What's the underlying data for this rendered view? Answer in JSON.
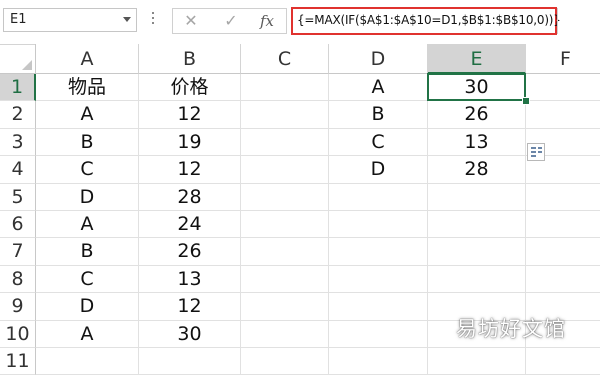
{
  "formula_bar": {
    "name_box": "E1",
    "cancel_icon": "✕",
    "enter_icon": "✓",
    "fx_icon": "fx",
    "formula": "{=MAX(IF($A$1:$A$10=D1,$B$1:$B$10,0))}"
  },
  "columns": [
    "A",
    "B",
    "C",
    "D",
    "E",
    "F"
  ],
  "rows": [
    "1",
    "2",
    "3",
    "4",
    "5",
    "6",
    "7",
    "8",
    "9",
    "10",
    "11"
  ],
  "selected": {
    "column": "E",
    "row": "1",
    "cell": "E1"
  },
  "cells": {
    "A": [
      "物品",
      "A",
      "B",
      "C",
      "D",
      "A",
      "B",
      "C",
      "D",
      "A"
    ],
    "B": [
      "价格",
      "12",
      "19",
      "12",
      "28",
      "24",
      "26",
      "13",
      "12",
      "30"
    ],
    "D": [
      "A",
      "B",
      "C",
      "D"
    ],
    "E": [
      "30",
      "26",
      "13",
      "28"
    ]
  },
  "watermark": "易坊好文馆",
  "colors": {
    "selection": "#217346",
    "formula_highlight": "#e0322f"
  },
  "icons": {
    "quick_analysis": "quick-analysis-icon"
  }
}
